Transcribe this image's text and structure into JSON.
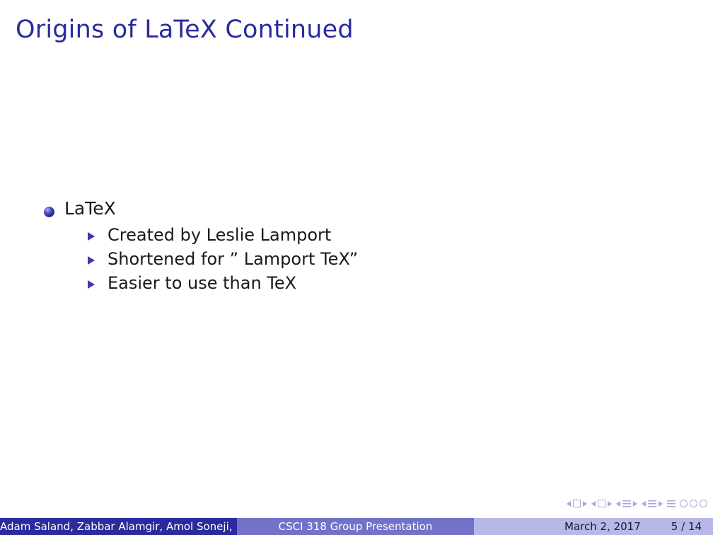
{
  "slide": {
    "title": "Origins of LaTeX Continued",
    "bullets": [
      {
        "label": "LaTeX",
        "subitems": [
          "Created by Leslie Lamport",
          "Shortened for ” Lamport TeX”",
          "Easier to use than TeX"
        ]
      }
    ]
  },
  "footer": {
    "authors": "Adam Saland, Zabbar Alamgir, Amol Soneji,",
    "presentation": "CSCI 318 Group Presentation",
    "date": "March 2, 2017",
    "page": "5 / 14"
  },
  "nav": {
    "icons": [
      "slide-nav-icon",
      "frame-nav-icon",
      "subsection-nav-icon",
      "section-nav-icon",
      "appendix-icon",
      "back-icon",
      "search-icon"
    ],
    "color": "#a8a8d8"
  },
  "theme": {
    "title_color": "#2b2b9e",
    "footer_left": "#2b2b9e",
    "footer_mid": "#7272c8",
    "footer_right": "#b8b8e8"
  }
}
